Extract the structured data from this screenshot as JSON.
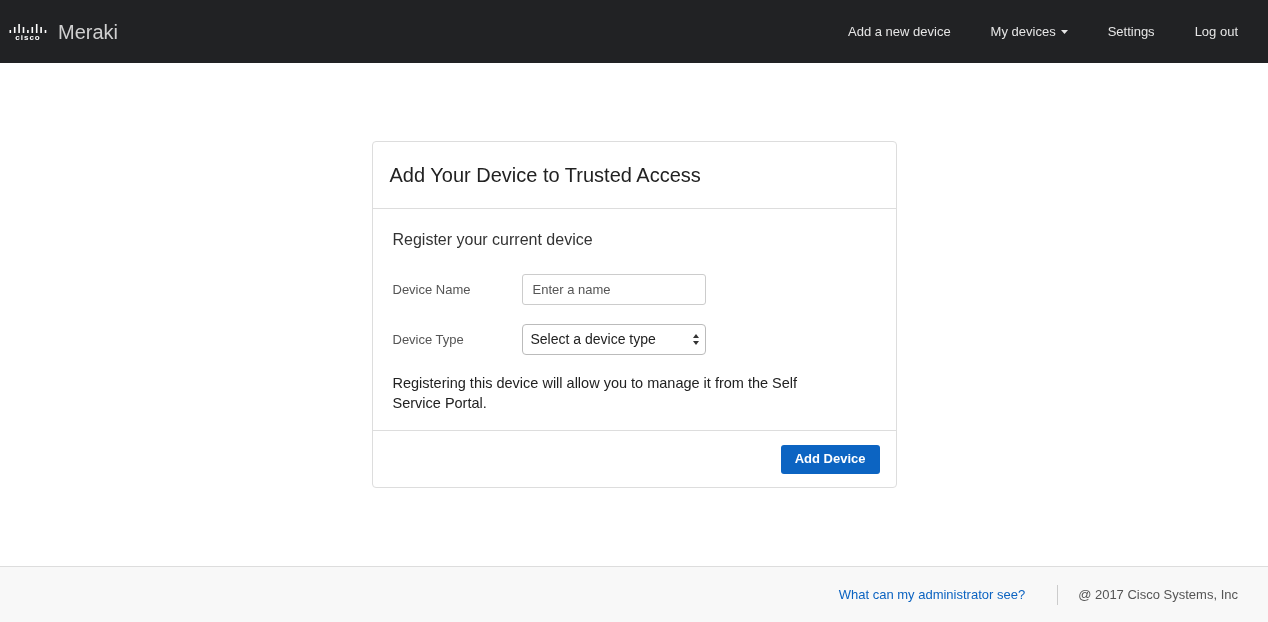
{
  "header": {
    "logo": {
      "text": "cisco"
    },
    "brand": "Meraki",
    "nav": [
      {
        "label": "Add a new device",
        "dropdown": false
      },
      {
        "label": "My devices",
        "dropdown": true
      },
      {
        "label": "Settings",
        "dropdown": false
      },
      {
        "label": "Log out",
        "dropdown": false
      }
    ]
  },
  "card": {
    "title": "Add Your Device to Trusted Access",
    "subtitle": "Register your current device",
    "fields": [
      {
        "kind": "text",
        "label": "Device Name",
        "placeholder": "Enter a name"
      },
      {
        "kind": "select",
        "label": "Device Type",
        "value": "Select a device type"
      }
    ],
    "note": "Registering this device will allow you to manage it from the Self Service Portal.",
    "button": "Add Device"
  },
  "footer": {
    "link": "What can my administrator see?",
    "copyright": "@ 2017 Cisco Systems, Inc"
  }
}
